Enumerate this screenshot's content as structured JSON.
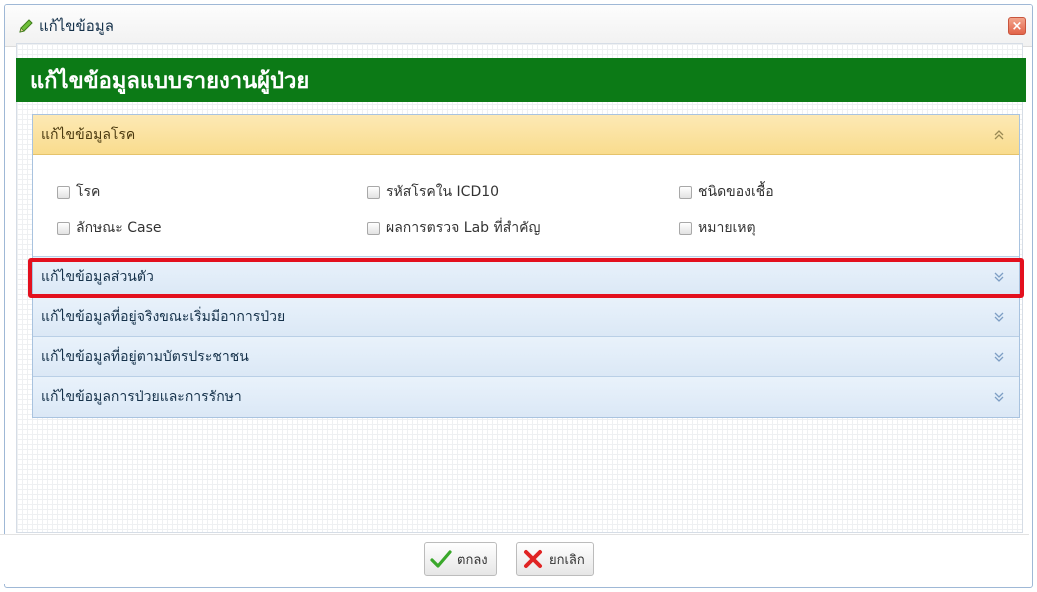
{
  "window": {
    "title": "แก้ไขข้อมูล",
    "close_label": "×"
  },
  "heading": "แก้ไขข้อมูลแบบรายงานผู้ป่วย",
  "sections": [
    {
      "label": "แก้ไขข้อมูลโรค",
      "expanded": true
    },
    {
      "label": "แก้ไขข้อมูลส่วนตัว",
      "expanded": false,
      "highlighted": true
    },
    {
      "label": "แก้ไขข้อมูลที่อยู่จริงขณะเริ่มมีอาการป่วย",
      "expanded": false
    },
    {
      "label": "แก้ไขข้อมูลที่อยู่ตามบัตรประชาชน",
      "expanded": false
    },
    {
      "label": "แก้ไขข้อมูลการป่วยและการรักษา",
      "expanded": false
    }
  ],
  "disease_fields": [
    {
      "label": "โรค",
      "checked": false
    },
    {
      "label": "รหัสโรคใน ICD10",
      "checked": false
    },
    {
      "label": "ชนิดของเชื้อ",
      "checked": false
    },
    {
      "label": "ลักษณะ Case",
      "checked": false
    },
    {
      "label": "ผลการตรวจ Lab ที่สำคัญ",
      "checked": false
    },
    {
      "label": "หมายเหตุ",
      "checked": false
    }
  ],
  "buttons": {
    "ok_label": "ตกลง",
    "cancel_label": "ยกเลิก"
  },
  "colors": {
    "heading_bg": "#0c7a16",
    "open_section_bg": "#f9dc8e",
    "section_bg": "#dbe8f6",
    "highlight_border": "#e3101e"
  }
}
